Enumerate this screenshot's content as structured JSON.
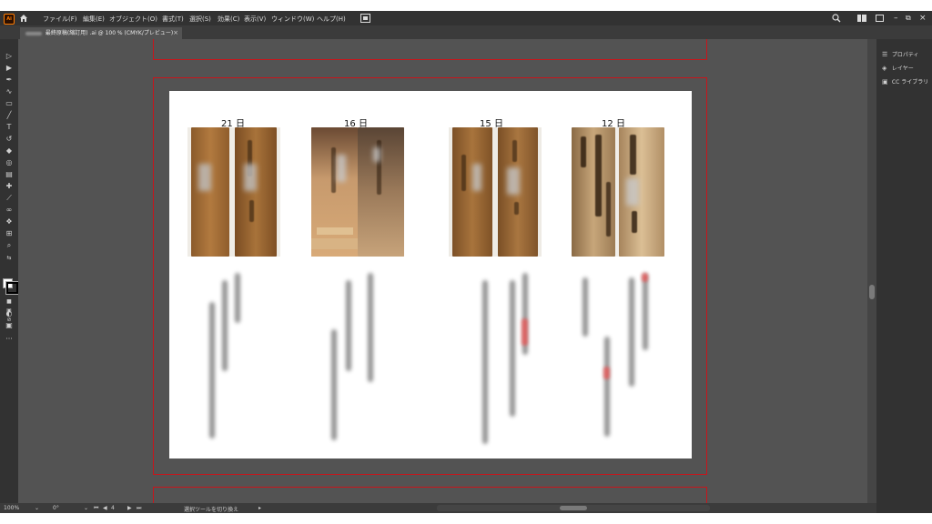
{
  "app": {
    "logo_text": "Ai"
  },
  "menu": {
    "items": [
      "ファイル(F)",
      "編集(E)",
      "オブジェクト(O)",
      "書式(T)",
      "選択(S)",
      "効果(C)",
      "表示(V)",
      "ウィンドウ(W)",
      "ヘルプ(H)"
    ]
  },
  "document_tab": {
    "label": "最終原稿(縮訂用) .ai @ 100 % (CMYK/プレビュー)",
    "close": "×"
  },
  "right_panel": {
    "items": [
      {
        "icon": "properties-icon",
        "label": "プロパティ"
      },
      {
        "icon": "layers-icon",
        "label": "レイヤー"
      },
      {
        "icon": "cc-libraries-icon",
        "label": "CC ライブラリ"
      }
    ]
  },
  "artboard": {
    "days": [
      "21 日",
      "16 日",
      "15 日",
      "12 日"
    ]
  },
  "status": {
    "zoom": "100%",
    "rotation": "0°",
    "artboard_num": "4",
    "tool_hint": "選択ツールを切り換え"
  },
  "colors": {
    "artboard_border": "#c8151b",
    "canvas": "#535353",
    "chrome": "#323232"
  }
}
